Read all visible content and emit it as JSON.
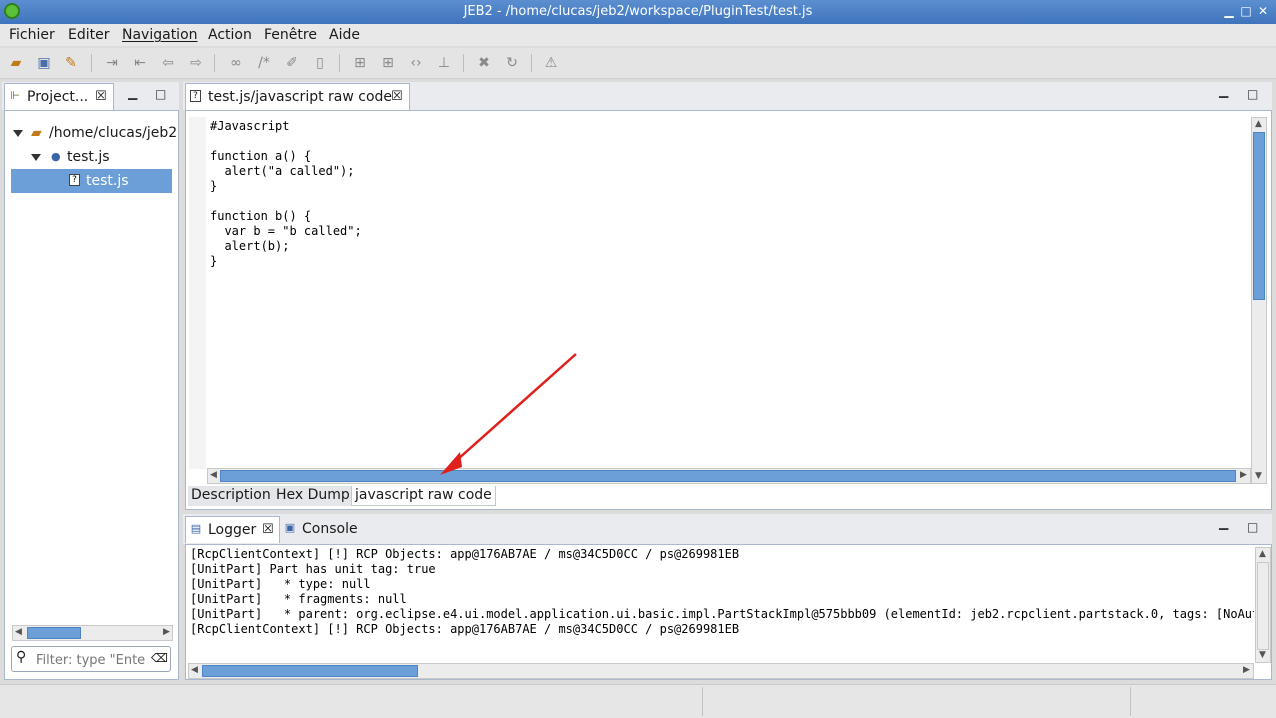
{
  "window": {
    "title": "JEB2 - /home/clucas/jeb2/workspace/PluginTest/test.js"
  },
  "menu": [
    "Fichier",
    "Editer",
    "Navigation",
    "Action",
    "Fenêtre",
    "Aide"
  ],
  "toolbar": {
    "icons": [
      "open-folder-icon",
      "save-icon",
      "wrench-icon",
      "jump-icon",
      "back-jump-icon",
      "back-icon",
      "forward-icon",
      "link-icon",
      "comment-icon",
      "rename-icon",
      "doc-icon",
      "grid-icon",
      "grid2-icon",
      "code-icon",
      "tree-icon",
      "delete-icon",
      "refresh-icon",
      "warning-icon"
    ]
  },
  "project_panel": {
    "tab_label": "Project...",
    "tree": [
      {
        "label": "/home/clucas/jeb2",
        "level": 0
      },
      {
        "label": "test.js",
        "level": 1
      },
      {
        "label": "test.js",
        "level": 2,
        "selected": true
      }
    ],
    "filter_placeholder": "Filter: type \"Enter\""
  },
  "editor": {
    "tab_label": "test.js/javascript raw code",
    "code": "#Javascript\n\nfunction a() {\n  alert(\"a called\");\n}\n\nfunction b() {\n  var b = \"b called\";\n  alert(b);\n}",
    "bottom_tabs": [
      "Description",
      "Hex Dump",
      "javascript raw code"
    ],
    "active_bottom_tab": 2
  },
  "bottom_panel": {
    "tabs": [
      "Logger",
      "Console"
    ],
    "log": "[RcpClientContext] [!] RCP Objects: app@176AB7AE / ms@34C5D0CC / ps@269981EB\n[UnitPart] Part has unit tag: true\n[UnitPart]   * type: null\n[UnitPart]   * fragments: null\n[UnitPart]   * parent: org.eclipse.e4.ui.model.application.ui.basic.impl.PartStackImpl@575bbb09 (elementId: jeb2.rcpclient.partstack.0, tags: [NoAutoCol\n[RcpClientContext] [!] RCP Objects: app@176AB7AE / ms@34C5D0CC / ps@269981EB"
  },
  "colors": {
    "titlebar": "#4a80c6",
    "selection": "#6c9fd8",
    "annotation_arrow": "#e0201c"
  }
}
